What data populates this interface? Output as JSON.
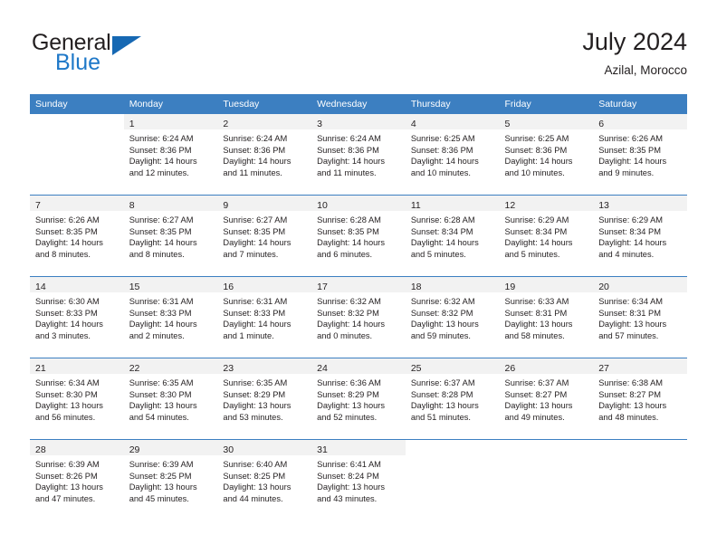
{
  "logo": {
    "text_top": "General",
    "text_bottom": "Blue",
    "accent_color": "#1668b3"
  },
  "header": {
    "title": "July 2024",
    "subtitle": "Azilal, Morocco",
    "header_bg_color": "#3c7fc1",
    "daynum_bg_color": "#f2f2f2"
  },
  "weekday_headers": [
    "Sunday",
    "Monday",
    "Tuesday",
    "Wednesday",
    "Thursday",
    "Friday",
    "Saturday"
  ],
  "weeks": [
    [
      {
        "day": "",
        "sunrise": "",
        "sunset": "",
        "daylight": "",
        "daylight2": ""
      },
      {
        "day": "1",
        "sunrise": "Sunrise: 6:24 AM",
        "sunset": "Sunset: 8:36 PM",
        "daylight": "Daylight: 14 hours",
        "daylight2": "and 12 minutes."
      },
      {
        "day": "2",
        "sunrise": "Sunrise: 6:24 AM",
        "sunset": "Sunset: 8:36 PM",
        "daylight": "Daylight: 14 hours",
        "daylight2": "and 11 minutes."
      },
      {
        "day": "3",
        "sunrise": "Sunrise: 6:24 AM",
        "sunset": "Sunset: 8:36 PM",
        "daylight": "Daylight: 14 hours",
        "daylight2": "and 11 minutes."
      },
      {
        "day": "4",
        "sunrise": "Sunrise: 6:25 AM",
        "sunset": "Sunset: 8:36 PM",
        "daylight": "Daylight: 14 hours",
        "daylight2": "and 10 minutes."
      },
      {
        "day": "5",
        "sunrise": "Sunrise: 6:25 AM",
        "sunset": "Sunset: 8:36 PM",
        "daylight": "Daylight: 14 hours",
        "daylight2": "and 10 minutes."
      },
      {
        "day": "6",
        "sunrise": "Sunrise: 6:26 AM",
        "sunset": "Sunset: 8:35 PM",
        "daylight": "Daylight: 14 hours",
        "daylight2": "and 9 minutes."
      }
    ],
    [
      {
        "day": "7",
        "sunrise": "Sunrise: 6:26 AM",
        "sunset": "Sunset: 8:35 PM",
        "daylight": "Daylight: 14 hours",
        "daylight2": "and 8 minutes."
      },
      {
        "day": "8",
        "sunrise": "Sunrise: 6:27 AM",
        "sunset": "Sunset: 8:35 PM",
        "daylight": "Daylight: 14 hours",
        "daylight2": "and 8 minutes."
      },
      {
        "day": "9",
        "sunrise": "Sunrise: 6:27 AM",
        "sunset": "Sunset: 8:35 PM",
        "daylight": "Daylight: 14 hours",
        "daylight2": "and 7 minutes."
      },
      {
        "day": "10",
        "sunrise": "Sunrise: 6:28 AM",
        "sunset": "Sunset: 8:35 PM",
        "daylight": "Daylight: 14 hours",
        "daylight2": "and 6 minutes."
      },
      {
        "day": "11",
        "sunrise": "Sunrise: 6:28 AM",
        "sunset": "Sunset: 8:34 PM",
        "daylight": "Daylight: 14 hours",
        "daylight2": "and 5 minutes."
      },
      {
        "day": "12",
        "sunrise": "Sunrise: 6:29 AM",
        "sunset": "Sunset: 8:34 PM",
        "daylight": "Daylight: 14 hours",
        "daylight2": "and 5 minutes."
      },
      {
        "day": "13",
        "sunrise": "Sunrise: 6:29 AM",
        "sunset": "Sunset: 8:34 PM",
        "daylight": "Daylight: 14 hours",
        "daylight2": "and 4 minutes."
      }
    ],
    [
      {
        "day": "14",
        "sunrise": "Sunrise: 6:30 AM",
        "sunset": "Sunset: 8:33 PM",
        "daylight": "Daylight: 14 hours",
        "daylight2": "and 3 minutes."
      },
      {
        "day": "15",
        "sunrise": "Sunrise: 6:31 AM",
        "sunset": "Sunset: 8:33 PM",
        "daylight": "Daylight: 14 hours",
        "daylight2": "and 2 minutes."
      },
      {
        "day": "16",
        "sunrise": "Sunrise: 6:31 AM",
        "sunset": "Sunset: 8:33 PM",
        "daylight": "Daylight: 14 hours",
        "daylight2": "and 1 minute."
      },
      {
        "day": "17",
        "sunrise": "Sunrise: 6:32 AM",
        "sunset": "Sunset: 8:32 PM",
        "daylight": "Daylight: 14 hours",
        "daylight2": "and 0 minutes."
      },
      {
        "day": "18",
        "sunrise": "Sunrise: 6:32 AM",
        "sunset": "Sunset: 8:32 PM",
        "daylight": "Daylight: 13 hours",
        "daylight2": "and 59 minutes."
      },
      {
        "day": "19",
        "sunrise": "Sunrise: 6:33 AM",
        "sunset": "Sunset: 8:31 PM",
        "daylight": "Daylight: 13 hours",
        "daylight2": "and 58 minutes."
      },
      {
        "day": "20",
        "sunrise": "Sunrise: 6:34 AM",
        "sunset": "Sunset: 8:31 PM",
        "daylight": "Daylight: 13 hours",
        "daylight2": "and 57 minutes."
      }
    ],
    [
      {
        "day": "21",
        "sunrise": "Sunrise: 6:34 AM",
        "sunset": "Sunset: 8:30 PM",
        "daylight": "Daylight: 13 hours",
        "daylight2": "and 56 minutes."
      },
      {
        "day": "22",
        "sunrise": "Sunrise: 6:35 AM",
        "sunset": "Sunset: 8:30 PM",
        "daylight": "Daylight: 13 hours",
        "daylight2": "and 54 minutes."
      },
      {
        "day": "23",
        "sunrise": "Sunrise: 6:35 AM",
        "sunset": "Sunset: 8:29 PM",
        "daylight": "Daylight: 13 hours",
        "daylight2": "and 53 minutes."
      },
      {
        "day": "24",
        "sunrise": "Sunrise: 6:36 AM",
        "sunset": "Sunset: 8:29 PM",
        "daylight": "Daylight: 13 hours",
        "daylight2": "and 52 minutes."
      },
      {
        "day": "25",
        "sunrise": "Sunrise: 6:37 AM",
        "sunset": "Sunset: 8:28 PM",
        "daylight": "Daylight: 13 hours",
        "daylight2": "and 51 minutes."
      },
      {
        "day": "26",
        "sunrise": "Sunrise: 6:37 AM",
        "sunset": "Sunset: 8:27 PM",
        "daylight": "Daylight: 13 hours",
        "daylight2": "and 49 minutes."
      },
      {
        "day": "27",
        "sunrise": "Sunrise: 6:38 AM",
        "sunset": "Sunset: 8:27 PM",
        "daylight": "Daylight: 13 hours",
        "daylight2": "and 48 minutes."
      }
    ],
    [
      {
        "day": "28",
        "sunrise": "Sunrise: 6:39 AM",
        "sunset": "Sunset: 8:26 PM",
        "daylight": "Daylight: 13 hours",
        "daylight2": "and 47 minutes."
      },
      {
        "day": "29",
        "sunrise": "Sunrise: 6:39 AM",
        "sunset": "Sunset: 8:25 PM",
        "daylight": "Daylight: 13 hours",
        "daylight2": "and 45 minutes."
      },
      {
        "day": "30",
        "sunrise": "Sunrise: 6:40 AM",
        "sunset": "Sunset: 8:25 PM",
        "daylight": "Daylight: 13 hours",
        "daylight2": "and 44 minutes."
      },
      {
        "day": "31",
        "sunrise": "Sunrise: 6:41 AM",
        "sunset": "Sunset: 8:24 PM",
        "daylight": "Daylight: 13 hours",
        "daylight2": "and 43 minutes."
      },
      {
        "day": "",
        "sunrise": "",
        "sunset": "",
        "daylight": "",
        "daylight2": ""
      },
      {
        "day": "",
        "sunrise": "",
        "sunset": "",
        "daylight": "",
        "daylight2": ""
      },
      {
        "day": "",
        "sunrise": "",
        "sunset": "",
        "daylight": "",
        "daylight2": ""
      }
    ]
  ]
}
